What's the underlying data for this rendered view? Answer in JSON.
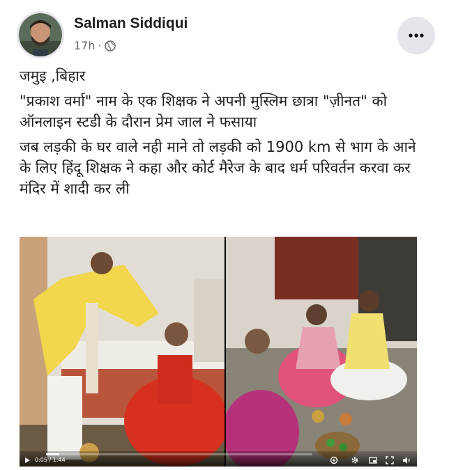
{
  "post": {
    "author": "Salman Siddiqui",
    "time": "17h",
    "separator": "·",
    "privacy_icon": "globe-icon",
    "more_icon": "more-horizontal-icon"
  },
  "body": {
    "location": "जमुइ ,बिहार",
    "para1": "\"प्रकाश वर्मा\" नाम के एक शिक्षक ने अपनी मुस्लिम छात्रा \"ज़ीनत\" को ऑनलाइन स्टडी के दौरान प्रेम जाल ने फसाया",
    "para2": "जब लड़की के घर वाले नही माने तो लड़की को 1900 km से भाग के आने के लिए हिंदू शिक्षक ने कहा और कोर्ट मैरेज के बाद धर्म परिवर्तन करवा कर मंदिर में शादी कर ली"
  },
  "video": {
    "time_display": "0:05 / 1:44",
    "progress": 0.05,
    "icons": [
      "play-icon",
      "volume-icon",
      "settings-icon",
      "pip-icon",
      "fullscreen-icon",
      "mute-icon"
    ]
  }
}
